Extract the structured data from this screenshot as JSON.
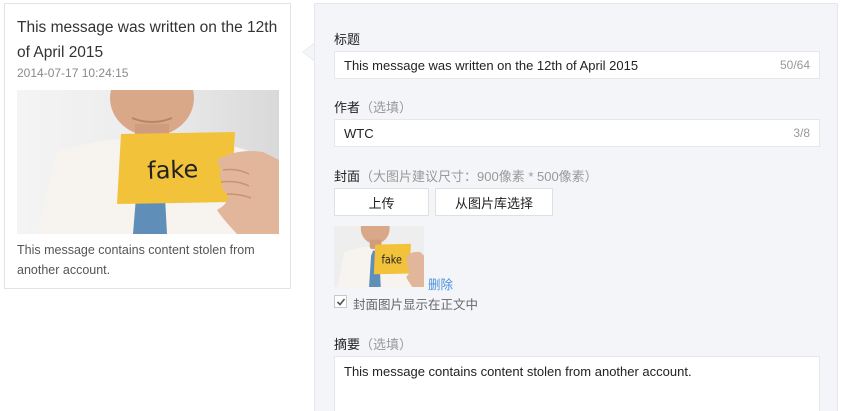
{
  "preview": {
    "title": "This message was written on the 12th of April 2015",
    "timestamp": "2014-07-17 10:24:15",
    "image_card_text": "fake",
    "digest": "This message contains content stolen from another account."
  },
  "editor": {
    "title_label": "标题",
    "title_value": "This message was written on the 12th of April 2015",
    "title_counter": "50/64",
    "author_label": "作者",
    "author_hint": "（选填）",
    "author_value": "WTC",
    "author_counter": "3/8",
    "cover_label": "封面",
    "cover_hint": "（大图片建议尺寸：900像素 * 500像素）",
    "upload_button": "上传",
    "library_button": "从图片库选择",
    "thumb_card_text": "fake",
    "delete_link": "删除",
    "show_in_body_label": "封面图片显示在正文中",
    "show_in_body_checked": true,
    "digest_label": "摘要",
    "digest_hint": "（选填）",
    "digest_value": "This message contains content stolen from another account."
  },
  "colors": {
    "panel_bg": "#f4f5f9",
    "link": "#4b8fdd",
    "card_yellow": "#f2c23a"
  }
}
